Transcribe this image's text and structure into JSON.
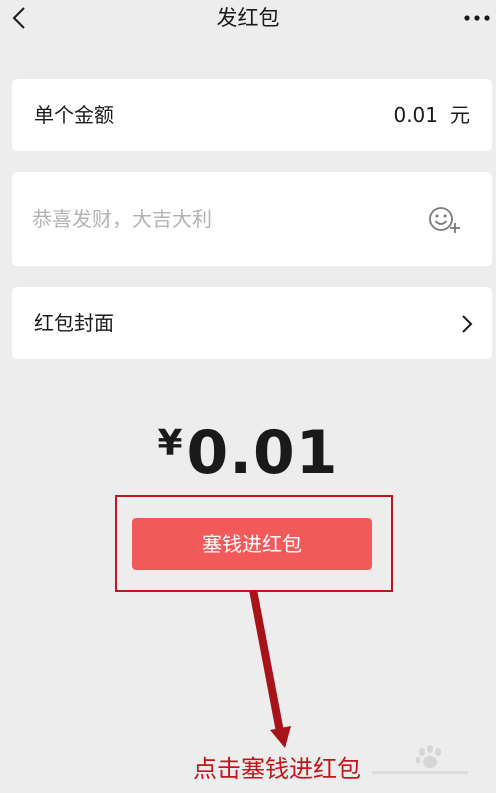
{
  "header": {
    "title": "发红包",
    "back_icon": "chevron-left-icon",
    "more_icon": "more-dots-icon"
  },
  "amount_row": {
    "label": "单个金额",
    "value": "0.01",
    "unit": "元"
  },
  "greeting": {
    "placeholder": "恭喜发财，大吉大利",
    "value": "",
    "emoji_icon": "emoji-add-icon"
  },
  "cover_row": {
    "label": "红包封面",
    "icon": "chevron-right-icon"
  },
  "total": {
    "currency": "¥",
    "amount": "0.01"
  },
  "submit_label": "塞钱进红包",
  "annotation": {
    "text": "点击塞钱进红包",
    "color": "#c0161c"
  },
  "colors": {
    "background": "#ededed",
    "button": "#f25a5a",
    "annotation": "#c0161c"
  }
}
